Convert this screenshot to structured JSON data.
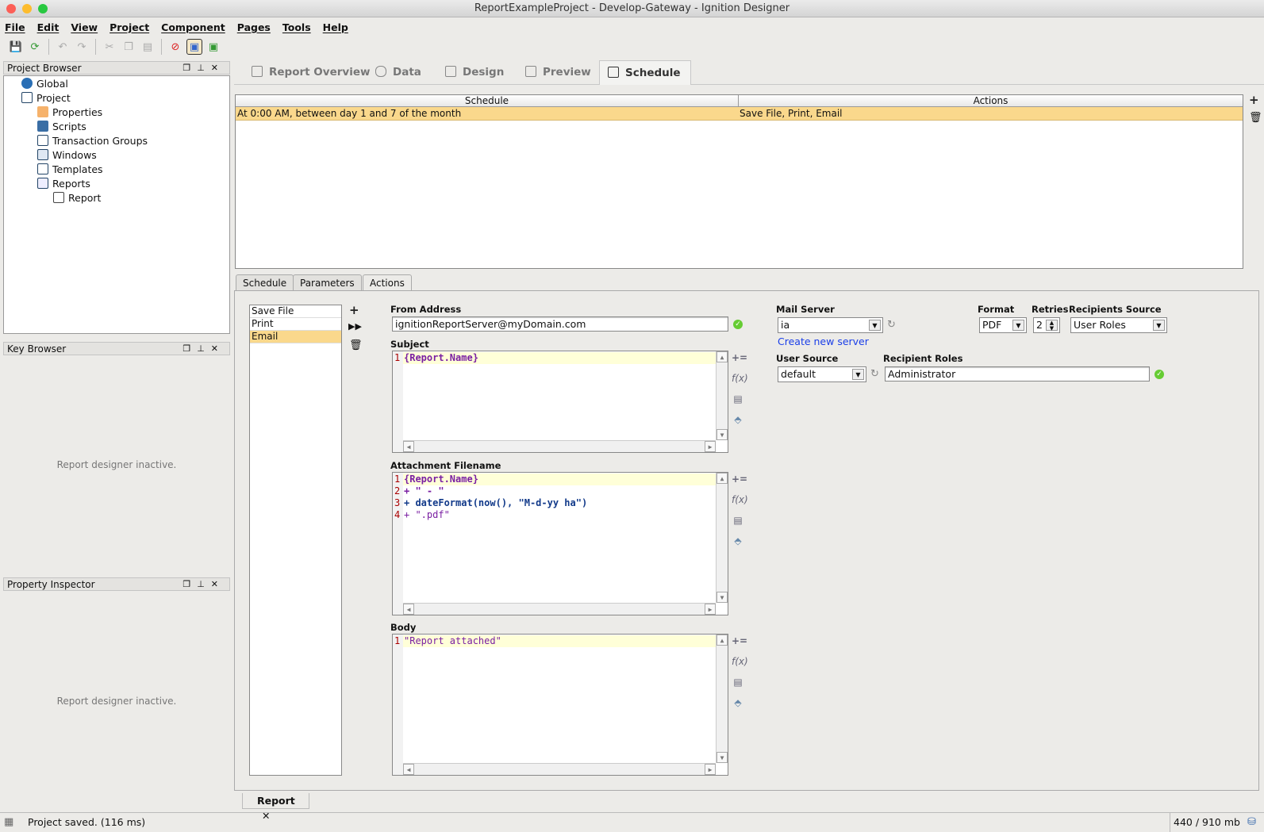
{
  "window": {
    "title": "ReportExampleProject - Develop-Gateway - Ignition Designer"
  },
  "menu": [
    "File",
    "Edit",
    "View",
    "Project",
    "Component",
    "Pages",
    "Tools",
    "Help"
  ],
  "toolbar": {
    "icons": [
      "save-icon",
      "refresh-icon",
      "undo-icon",
      "redo-icon",
      "cut-icon",
      "copy-icon",
      "paste-icon",
      "disconnect-icon",
      "comm-read-write-icon",
      "comm-sync-icon"
    ]
  },
  "project_browser": {
    "title": "Project Browser",
    "tree": [
      "Global",
      "Project",
      "Properties",
      "Scripts",
      "Transaction Groups",
      "Windows",
      "Templates",
      "Reports",
      "Report"
    ]
  },
  "key_browser": {
    "title": "Key Browser",
    "message": "Report designer inactive."
  },
  "property_inspector": {
    "title": "Property Inspector",
    "message": "Report designer inactive."
  },
  "main_tabs": [
    "Report Overview",
    "Data",
    "Design",
    "Preview",
    "Schedule"
  ],
  "schedule_table": {
    "columns": [
      "Schedule",
      "Actions"
    ],
    "rows": [
      [
        "At 0:00 AM, between day 1 and 7 of the month",
        "Save File, Print, Email"
      ]
    ]
  },
  "sub_tabs": [
    "Schedule",
    "Parameters",
    "Actions"
  ],
  "actions": {
    "list": [
      "Save File",
      "Print",
      "Email"
    ],
    "selected": "Email"
  },
  "email": {
    "from_label": "From Address",
    "from_value": "ignitionReportServer@myDomain.com",
    "subject_label": "Subject",
    "subject_lines": [
      "{Report.Name}"
    ],
    "attachment_label": "Attachment Filename",
    "attachment_lines": [
      "{Report.Name}",
      "+ \" - \"",
      "+ dateFormat(now(), \"M-d-yy ha\")",
      "+ \".pdf\""
    ],
    "body_label": "Body",
    "body_lines": [
      "\"Report attached\""
    ],
    "mail_server_label": "Mail Server",
    "mail_server": "ia",
    "create_server_link": "Create new server",
    "format_label": "Format",
    "format": "PDF",
    "retries_label": "Retries",
    "retries": "2",
    "recipients_source_label": "Recipients Source",
    "recipients_source": "User Roles",
    "user_source_label": "User Source",
    "user_source": "default",
    "recipient_roles_label": "Recipient Roles",
    "recipient_roles": "Administrator"
  },
  "bottom_tab": {
    "label": "Report"
  },
  "status": {
    "message": "Project saved. (116 ms)",
    "memory": "440 / 910 mb"
  },
  "colors": {
    "selection": "#fad88c",
    "link": "#1a3ee8",
    "code_purple": "#7a1fa2",
    "ok_green": "#66cc33"
  }
}
